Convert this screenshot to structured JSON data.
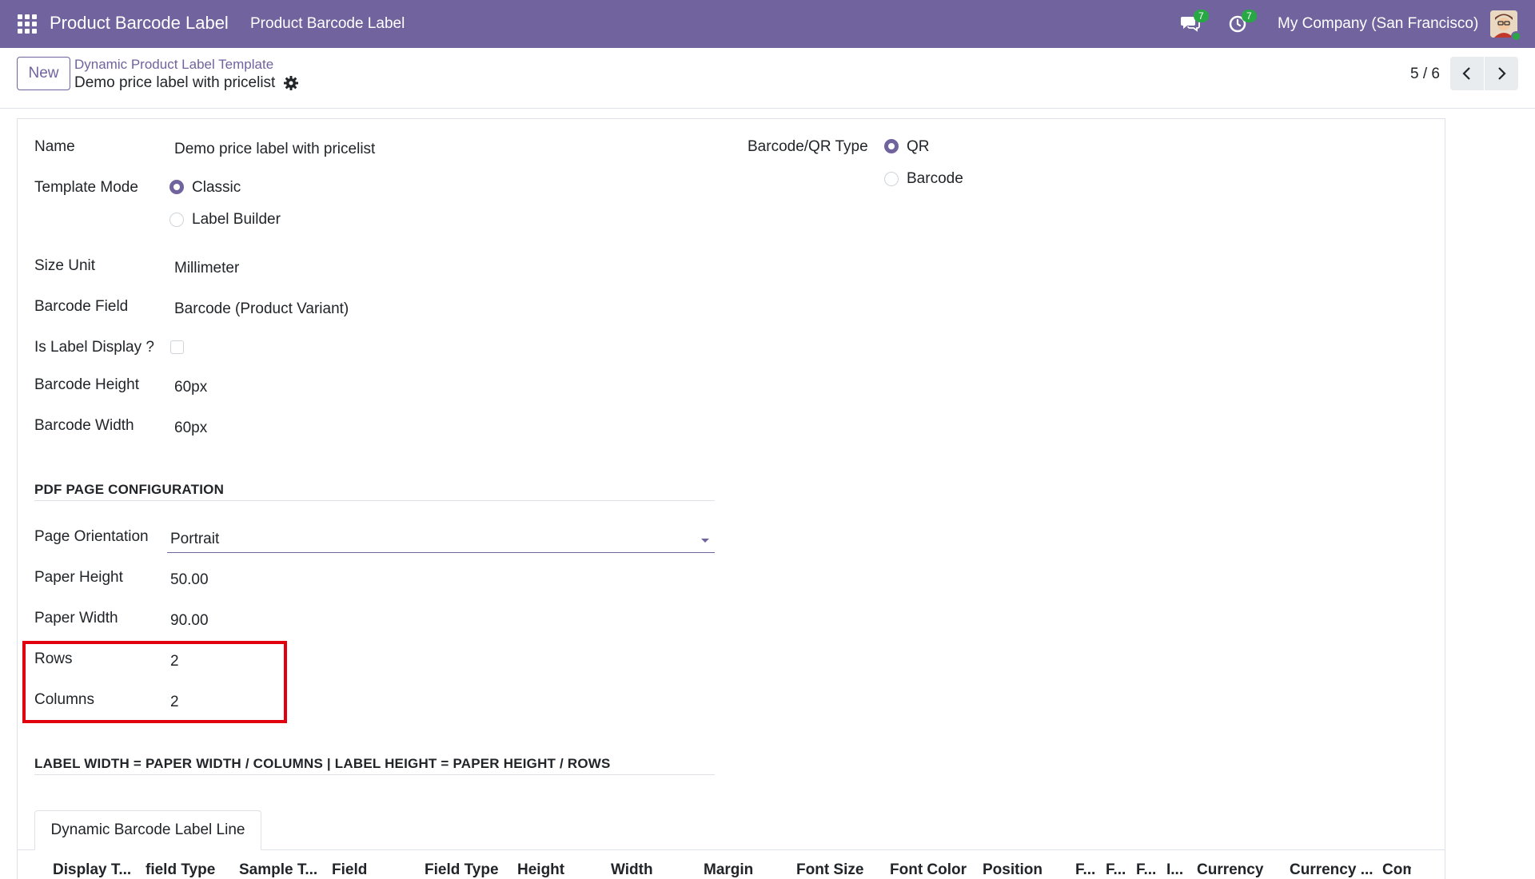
{
  "navbar": {
    "app_name": "Product Barcode Label",
    "menu_item": "Product Barcode Label",
    "messages_count": "7",
    "activities_count": "7",
    "company": "My Company (San Francisco)",
    "color": "#71639e"
  },
  "control_panel": {
    "new_label": "New",
    "breadcrumb_parent": "Dynamic Product Label Template",
    "breadcrumb_current": "Demo price label with pricelist",
    "pager": "5 / 6"
  },
  "form": {
    "name_label": "Name",
    "name_value": "Demo price label with pricelist",
    "template_mode_label": "Template Mode",
    "template_mode_options": [
      "Classic",
      "Label Builder"
    ],
    "template_mode_selected": "Classic",
    "size_unit_label": "Size Unit",
    "size_unit_value": "Millimeter",
    "barcode_field_label": "Barcode Field",
    "barcode_field_value": "Barcode (Product Variant)",
    "is_label_display_label": "Is Label Display ?",
    "is_label_display_checked": false,
    "barcode_height_label": "Barcode Height",
    "barcode_height_value": "60px",
    "barcode_width_label": "Barcode Width",
    "barcode_width_value": "60px",
    "barcode_type_label": "Barcode/QR Type",
    "barcode_type_options": [
      "QR",
      "Barcode"
    ],
    "barcode_type_selected": "QR",
    "pdf_section_title": "PDF PAGE CONFIGURATION",
    "page_orientation_label": "Page Orientation",
    "page_orientation_value": "Portrait",
    "paper_height_label": "Paper Height",
    "paper_height_value": "50.00",
    "paper_width_label": "Paper Width",
    "paper_width_value": "90.00",
    "rows_label": "Rows",
    "rows_value": "2",
    "columns_label": "Columns",
    "columns_value": "2",
    "formula_section_title": "LABEL WIDTH = PAPER WIDTH / COLUMNS | LABEL HEIGHT = PAPER HEIGHT / ROWS"
  },
  "notebook": {
    "tab_label": "Dynamic Barcode Label Line",
    "columns": [
      "Display T...",
      "field Type",
      "Sample T...",
      "Field",
      "Field Type",
      "Height",
      "Width",
      "Margin",
      "Font Size",
      "Font Color",
      "Position",
      "F...",
      "F...",
      "F...",
      "I...",
      "Currency",
      "Currency ...",
      "Com"
    ]
  },
  "highlight_color": "#e1000e"
}
